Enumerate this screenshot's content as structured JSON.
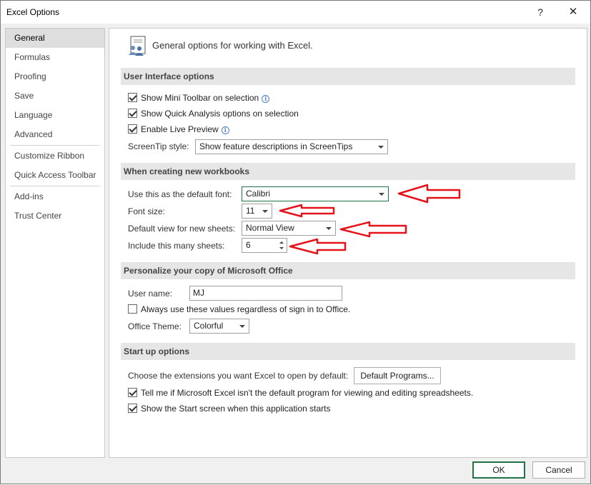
{
  "window": {
    "title": "Excel Options",
    "help": "?",
    "close": "✕"
  },
  "nav": {
    "items": [
      {
        "label": "General",
        "selected": true
      },
      {
        "label": "Formulas"
      },
      {
        "label": "Proofing"
      },
      {
        "label": "Save"
      },
      {
        "label": "Language"
      },
      {
        "label": "Advanced"
      },
      {
        "label": "Customize Ribbon"
      },
      {
        "label": "Quick Access Toolbar"
      },
      {
        "label": "Add-ins"
      },
      {
        "label": "Trust Center"
      }
    ]
  },
  "header": {
    "text": "General options for working with Excel."
  },
  "ui_options": {
    "title": "User Interface options",
    "mini_toolbar": "Show Mini Toolbar on selection",
    "quick_analysis": "Show Quick Analysis options on selection",
    "live_preview": "Enable Live Preview",
    "screentip_label": "ScreenTip style:",
    "screentip_value": "Show feature descriptions in ScreenTips"
  },
  "new_workbooks": {
    "title": "When creating new workbooks",
    "font_label": "Use this as the default font:",
    "font_value": "Calibri",
    "size_label": "Font size:",
    "size_value": "11",
    "view_label": "Default view for new sheets:",
    "view_value": "Normal View",
    "sheets_label": "Include this many sheets:",
    "sheets_value": "6"
  },
  "personalize": {
    "title": "Personalize your copy of Microsoft Office",
    "user_label": "User name:",
    "user_value": "MJ",
    "always_use": "Always use these values regardless of sign in to Office.",
    "theme_label": "Office Theme:",
    "theme_value": "Colorful"
  },
  "startup": {
    "title": "Start up options",
    "extensions_label": "Choose the extensions you want Excel to open by default:",
    "default_programs": "Default Programs...",
    "tell_me": "Tell me if Microsoft Excel isn't the default program for viewing and editing spreadsheets.",
    "show_start": "Show the Start screen when this application starts"
  },
  "footer": {
    "ok": "OK",
    "cancel": "Cancel"
  },
  "colors": {
    "accent": "#217346",
    "annotation": "#e3121b"
  }
}
